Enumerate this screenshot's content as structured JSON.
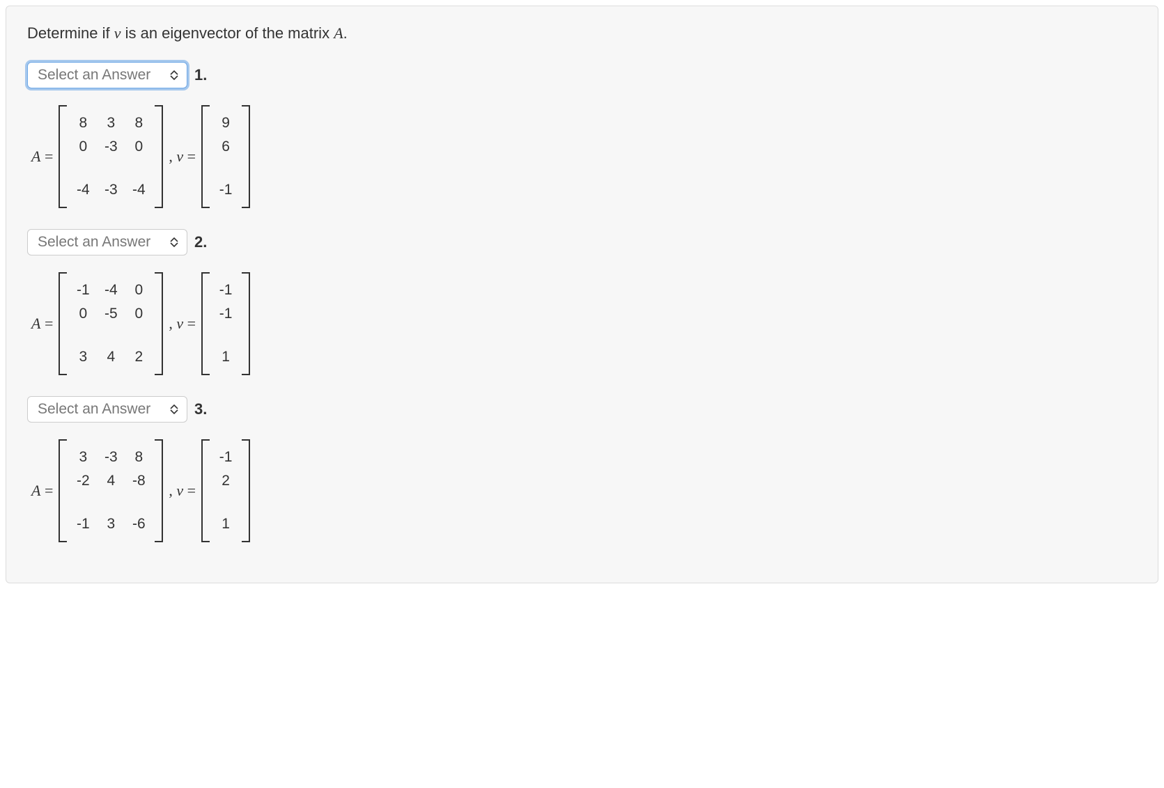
{
  "question": {
    "prefix": "Determine if ",
    "v": "v",
    "mid": " is an eigenvector of the matrix ",
    "A": "A",
    "suffix": "."
  },
  "select_placeholder": "Select an Answer",
  "labels": {
    "A_eq": "A",
    "eq": " = ",
    "v_eq": "v",
    "comma": ", "
  },
  "parts": [
    {
      "number": "1.",
      "focused": true,
      "A": [
        [
          "8",
          "3",
          "8"
        ],
        [
          "0",
          "-3",
          "0"
        ],
        [
          "-4",
          "-3",
          "-4"
        ]
      ],
      "v": [
        [
          "9"
        ],
        [
          "6"
        ],
        [
          "-1"
        ]
      ]
    },
    {
      "number": "2.",
      "focused": false,
      "A": [
        [
          "-1",
          "-4",
          "0"
        ],
        [
          "0",
          "-5",
          "0"
        ],
        [
          "3",
          "4",
          "2"
        ]
      ],
      "v": [
        [
          "-1"
        ],
        [
          "-1"
        ],
        [
          "1"
        ]
      ]
    },
    {
      "number": "3.",
      "focused": false,
      "A": [
        [
          "3",
          "-3",
          "8"
        ],
        [
          "-2",
          "4",
          "-8"
        ],
        [
          "-1",
          "3",
          "-6"
        ]
      ],
      "v": [
        [
          "-1"
        ],
        [
          "2"
        ],
        [
          "1"
        ]
      ]
    }
  ]
}
